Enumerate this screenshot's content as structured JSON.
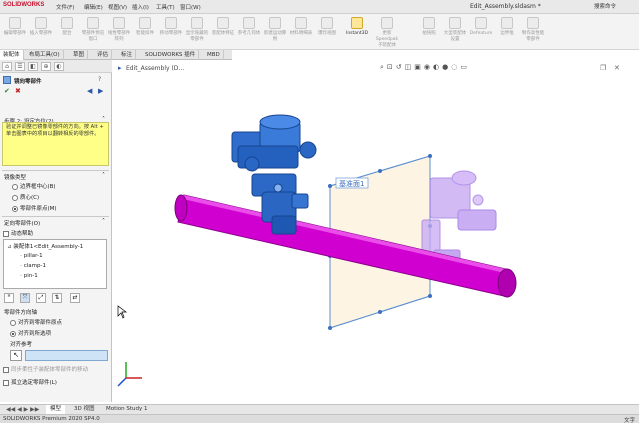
{
  "app": {
    "logo": "SOLIDWORKS",
    "menus": [
      "文件(F)",
      "编辑(E)",
      "视图(V)",
      "插入(I)",
      "工具(T)",
      "窗口(W)"
    ],
    "doc_title": "Edit_Assembly.sldasm *",
    "help_search": "搜索命令"
  },
  "ribbon": {
    "buttons": [
      {
        "label": "编辑零部件",
        "on": false
      },
      {
        "label": "插入零部件",
        "on": false
      },
      {
        "label": "配合",
        "on": false
      },
      {
        "label": "零部件预览窗口",
        "on": false
      },
      {
        "label": "线性零部件阵列",
        "on": false
      },
      {
        "label": "智能扣件",
        "on": false
      },
      {
        "label": "移动零部件",
        "on": false
      },
      {
        "label": "显示隐藏的零部件",
        "on": false
      },
      {
        "label": "装配体特征",
        "on": false
      },
      {
        "label": "参考几何体",
        "on": false
      },
      {
        "label": "新建运动算例",
        "on": false
      },
      {
        "label": "材料明细表",
        "on": false
      },
      {
        "label": "爆炸视图",
        "on": false
      },
      {
        "label": "Instant3D",
        "on": true
      },
      {
        "label": "更新Speedpak子装配体",
        "on": false
      },
      {
        "label": "拍快照",
        "on": false
      },
      {
        "label": "大型装配体设置",
        "on": false
      },
      {
        "label": "Defeature",
        "on": false
      },
      {
        "label": "边界框",
        "on": false
      },
      {
        "label": "制作高性能零部件",
        "on": false
      }
    ]
  },
  "command_tabs": [
    "装配体",
    "布局工具(O)",
    "草图",
    "评估",
    "标注",
    "SOLIDWORKS 插件",
    "MBD"
  ],
  "property_manager": {
    "title": "镜向零部件",
    "step_title": "步骤 2: 设定方位(2)",
    "step_text": "验证并调整已镜像零部件的方向。按 Alt + 单击图表中的项目以翻转相反的零部件。",
    "mirror_type_header": "镜像类型",
    "mirror_types": [
      {
        "label": "边界框中心(B)",
        "selected": false
      },
      {
        "label": "质心(C)",
        "selected": false
      },
      {
        "label": "零部件原点(M)",
        "selected": true
      }
    ],
    "orient_header": "定向零部件(O)",
    "dynamic_help": "动态帮助",
    "tree_root": "装配体1<Edit_Assembly-1",
    "tree_items": [
      "pillar-1",
      "clamp-1",
      "pin-1"
    ],
    "axis_header": "零部件方向轴",
    "axis_options": [
      {
        "label": "对齐到零部件原点",
        "selected": false
      },
      {
        "label": "对齐到所选项",
        "selected": true
      }
    ],
    "align_ref": "对齐参考",
    "sync_label": "同步柔性子装配体零部件的移动",
    "float_label": "孤立选定零部件(L)"
  },
  "graphics": {
    "tree_label": "Edit_Assembly (D...",
    "plane_label": "基准面1"
  },
  "bottom_tabs": [
    "模型",
    "3D 视图",
    "Motion Study 1"
  ],
  "status": {
    "left": "SOLIDWORKS Premium 2020 SP4.0",
    "right": "文字"
  },
  "colors": {
    "accent_blue": "#1f6fd1",
    "cylinder_magenta": "#d600d6",
    "mirror_violet": "#b68cf0",
    "highlight_yellow": "#ffff88"
  }
}
